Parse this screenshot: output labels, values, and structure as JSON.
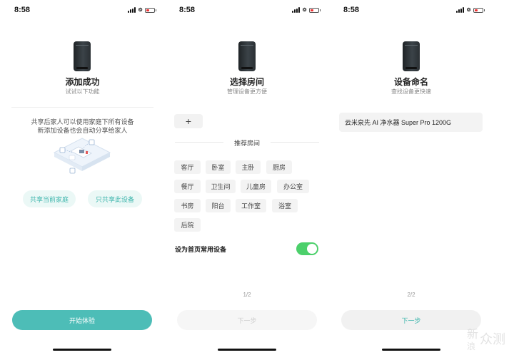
{
  "colors": {
    "accent": "#4dbdb7",
    "pill_bg": "#ebf8f6",
    "toggle_on": "#4cd06b"
  },
  "panels": [
    {
      "status_time": "8:58",
      "title": "添加成功",
      "subtitle": "试试以下功能",
      "share_line1": "共享后家人可以使用家庭下所有设备",
      "share_line2": "新添加设备也会自动分享给家人",
      "option_share_home": "共享当前家庭",
      "option_share_device": "只共享此设备",
      "start_button": "开始体验"
    },
    {
      "status_time": "8:58",
      "title": "选择房间",
      "subtitle": "管理设备更方便",
      "add_glyph": "+",
      "section_label": "推荐房间",
      "rooms": [
        "客厅",
        "卧室",
        "主卧",
        "厨房",
        "餐厅",
        "卫生间",
        "儿童房",
        "办公室",
        "书房",
        "阳台",
        "工作室",
        "浴室",
        "后院"
      ],
      "toggle_label": "设为首页常用设备",
      "toggle_on": true,
      "page_indicator": "1/2",
      "next_button": "下一步"
    },
    {
      "status_time": "8:58",
      "title": "设备命名",
      "subtitle": "查找设备更快速",
      "device_name": "云米泉先 AI 净水器 Super Pro 1200G",
      "page_indicator": "2/2",
      "next_button": "下一步"
    }
  ],
  "watermark": "新 众测",
  "icons": [
    "signal-icon",
    "link-icon",
    "battery-icon",
    "purifier-device-icon",
    "home-share-illustration",
    "plus-icon"
  ]
}
